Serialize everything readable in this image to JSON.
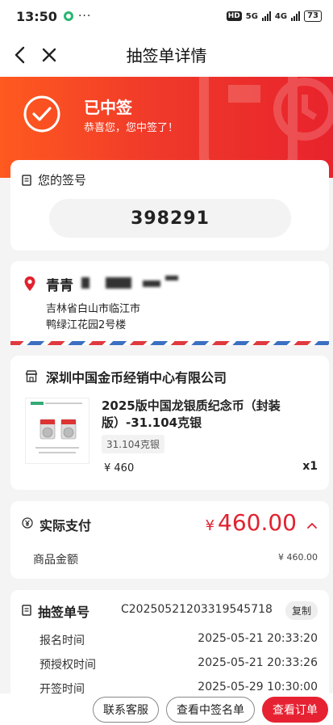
{
  "status_bar": {
    "time": "13:50",
    "more": "···",
    "hd": "HD",
    "net1": "5G",
    "net2": "4G",
    "battery": "73"
  },
  "nav": {
    "title": "抽签单详情"
  },
  "hero": {
    "status": "已中签",
    "subtitle": "恭喜您，您中签了！"
  },
  "lottery": {
    "label": "您的签号",
    "number": "398291"
  },
  "address": {
    "name": "青青",
    "line1": "吉林省白山市临江市",
    "line2": "鸭绿江花园2号楼"
  },
  "product": {
    "shop": "深圳中国金币经销中心有限公司",
    "name": "2025版中国龙银质纪念币（封装版）-31.104克银",
    "spec": "31.104克银",
    "price": "¥ 460",
    "qty": "x1"
  },
  "payment": {
    "label": "实际支付",
    "currency": "¥",
    "amount": "460.00",
    "goods_label": "商品金额",
    "goods_value": "¥ 460.00"
  },
  "order": {
    "label": "抽签单号",
    "number": "C2025052120331954571​8",
    "copy": "复制",
    "rows": [
      {
        "label": "报名时间",
        "value": "2025-05-21 20:33:20"
      },
      {
        "label": "预授权时间",
        "value": "2025-05-21 20:33:26"
      },
      {
        "label": "开签时间",
        "value": "2025-05-29 10:30:00"
      }
    ]
  },
  "actions": {
    "service": "联系客服",
    "winners": "查看中签名单",
    "view_order": "查看订单"
  },
  "colors": {
    "accent": "#e62232",
    "hero_start": "#ff5a1f",
    "hero_end": "#e8232c"
  }
}
